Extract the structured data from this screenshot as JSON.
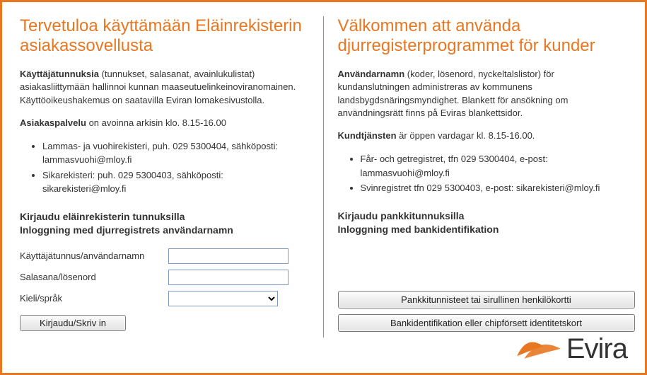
{
  "left": {
    "heading": "Tervetuloa käyttämään Eläinrekisterin asiakassovellusta",
    "intro_bold": "Käyttäjätunnuksia",
    "intro_rest": " (tunnukset, salasanat, avainlukulistat) asiakasliittymään hallinnoi kunnan maaseutuelinkeinoviranomainen. Käyttöoikeushakemus on saatavilla Eviran lomakesivustolla.",
    "service_bold": "Asiakaspalvelu",
    "service_rest": " on avoinna arkisin klo. 8.15-16.00",
    "contact1": "Lammas- ja vuohirekisteri, puh. 029 5300404, sähköposti: lammasvuohi@mloy.fi",
    "contact2": "Sikarekisteri: puh. 029 5300403, sähköposti: sikarekisteri@mloy.fi",
    "login_heading_line1": "Kirjaudu eläinrekisterin tunnuksilla",
    "login_heading_line2": "Inloggning med djurregistrets användarnamn",
    "label_username": "Käyttäjätunnus/användarnamn",
    "label_password": "Salasana/lösenord",
    "label_language": "Kieli/språk",
    "btn_login": "Kirjaudu/Skriv in"
  },
  "right": {
    "heading": "Välkommen att använda djurregisterprogrammet för kunder",
    "intro_bold": "Användarnamn",
    "intro_rest": " (koder, lösenord, nyckeltalslistor) för kundanslutningen administreras av kommunens landsbygdsnäringsmyndighet. Blankett för ansökning om användningsrätt finns på Eviras blankettsidor.",
    "service_bold": "Kundtjänsten",
    "service_rest": " är öppen vardagar kl. 8.15-16.00.",
    "contact1": "Får- och getregistret, tfn 029 5300404, e-post: lammasvuohi@mloy.fi",
    "contact2": "Svinregistret tfn 029 5300403, e-post: sikarekisteri@mloy.fi",
    "login_heading_line1": "Kirjaudu pankkitunnuksilla",
    "login_heading_line2": "Inloggning med bankidentifikation",
    "btn_bank_fi": "Pankkitunnisteet tai sirullinen henkilökortti",
    "btn_bank_sv": "Bankidentifikation eller chipförsett identitetskort"
  },
  "logo_text": "Evira"
}
